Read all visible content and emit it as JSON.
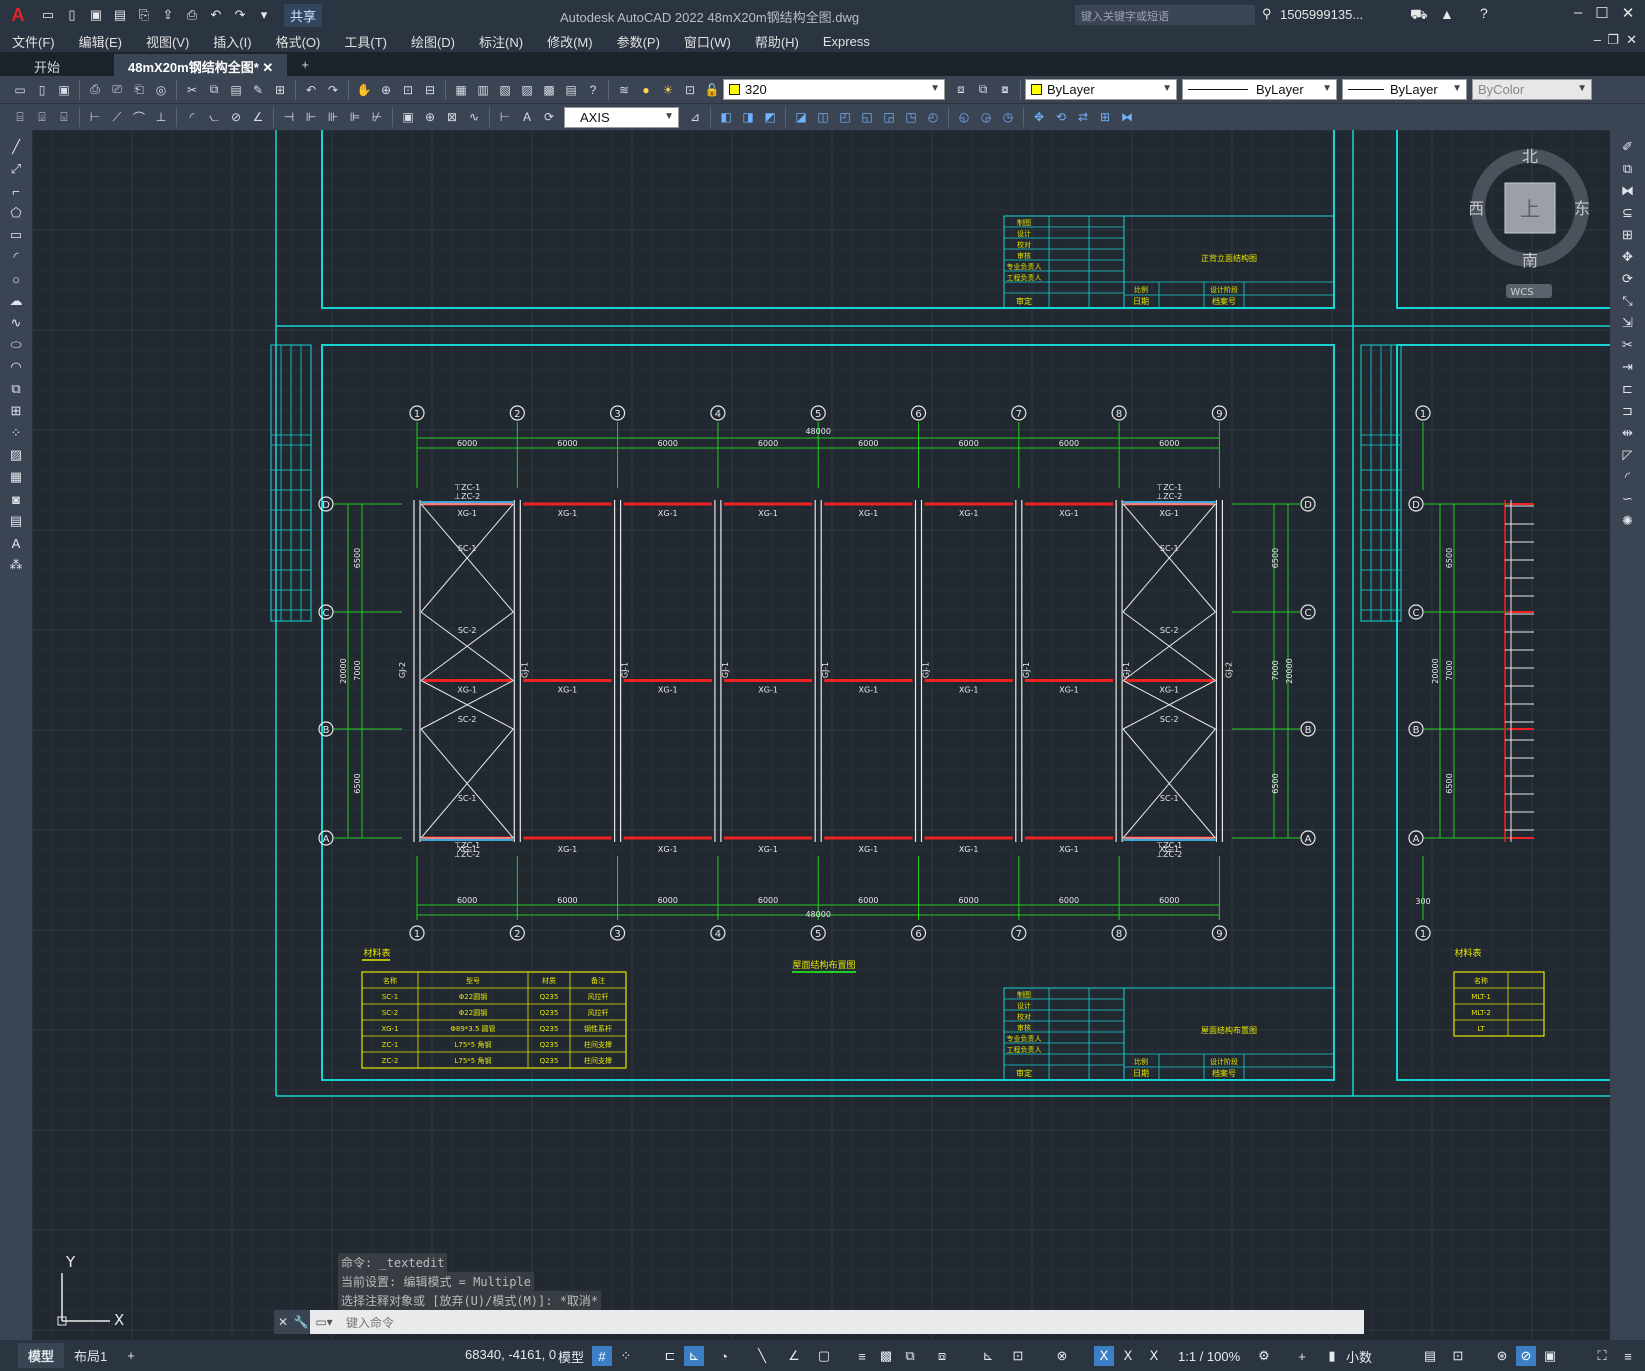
{
  "app": {
    "title": "Autodesk AutoCAD 2022    48mX20m钢结构全图.dwg",
    "logo": "A",
    "share_label": "共享",
    "search_placeholder": "键入关键字或短语",
    "user": "1505999135..."
  },
  "menus": [
    "文件(F)",
    "编辑(E)",
    "视图(V)",
    "插入(I)",
    "格式(O)",
    "工具(T)",
    "绘图(D)",
    "标注(N)",
    "修改(M)",
    "参数(P)",
    "窗口(W)",
    "帮助(H)",
    "Express"
  ],
  "tabs": {
    "start": "开始",
    "active": "48mX20m钢结构全图*",
    "add": "+"
  },
  "layers": {
    "current": "320",
    "color": "ByLayer",
    "linetype": "ByLayer",
    "lineweight": "ByLayer",
    "plotstyle": "ByColor"
  },
  "dimstyle": "AXIS",
  "viewcube": {
    "north": "北",
    "south": "南",
    "east": "东",
    "west": "西",
    "top": "上",
    "wcs": "WCS"
  },
  "ucs": {
    "x": "X",
    "y": "Y"
  },
  "command": {
    "history": [
      "命令: _textedit",
      "当前设置: 编辑模式 = Multiple",
      "选择注释对象或 [放弃(U)/模式(M)]: *取消*"
    ],
    "placeholder": "键入命令"
  },
  "status": {
    "layout_tabs": [
      "模型",
      "布局1"
    ],
    "coords": "68340, -4161, 0",
    "model_label": "模型",
    "scale": "1:1 / 100%",
    "units": "小数"
  },
  "drawing": {
    "grid_labels": [
      "1",
      "2",
      "3",
      "4",
      "5",
      "6",
      "7",
      "8",
      "9"
    ],
    "row_labels": [
      "D",
      "C",
      "B",
      "A"
    ],
    "bay_dim": "6000",
    "total_dim": "48000",
    "left_dims": [
      "6500",
      "7000",
      "6500"
    ],
    "total_depth": "20000",
    "edge_dim": "300",
    "purlin": "XG-1",
    "brace1": "SC-1",
    "brace2": "SC-2",
    "frame_mid": "GJ-1",
    "frame_end": "GJ-2",
    "col_brace1": "ZC-1",
    "col_brace2": "ZC-2",
    "plan_title": "屋面结构布置图",
    "top_sheet_title": "正背立面结构图",
    "material_title": "材料表",
    "material_headers": [
      "名称",
      "型号",
      "材质",
      "备注"
    ],
    "material_rows": [
      [
        "SC-1",
        "Φ22圆钢",
        "Q235",
        "风拉杆"
      ],
      [
        "SC-2",
        "Φ22圆钢",
        "Q235",
        "风拉杆"
      ],
      [
        "XG-1",
        "Φ89*3.5 圆管",
        "Q235",
        "钢性系杆"
      ],
      [
        "ZC-1",
        "L75*5 角钢",
        "Q235",
        "柱间支撑"
      ],
      [
        "ZC-2",
        "L75*5 角钢",
        "Q235",
        "柱间支撑"
      ]
    ],
    "right_material_rows": [
      "MLT-1",
      "MLT-2",
      "LT"
    ],
    "titleblock_rows": [
      "制图",
      "设计",
      "校对",
      "审核",
      "专业负责人",
      "工程负责人"
    ],
    "titleblock_bottom": [
      "审定",
      "日期",
      "档案号",
      "比例",
      "设计阶段"
    ]
  },
  "colors": {
    "cyan": "#17d4d4",
    "green": "#22cc22",
    "red": "#ee2222",
    "yellow": "#e6e600",
    "white": "#e8e8e8",
    "canvas": "#212830",
    "accent": "#3c7fc4"
  }
}
